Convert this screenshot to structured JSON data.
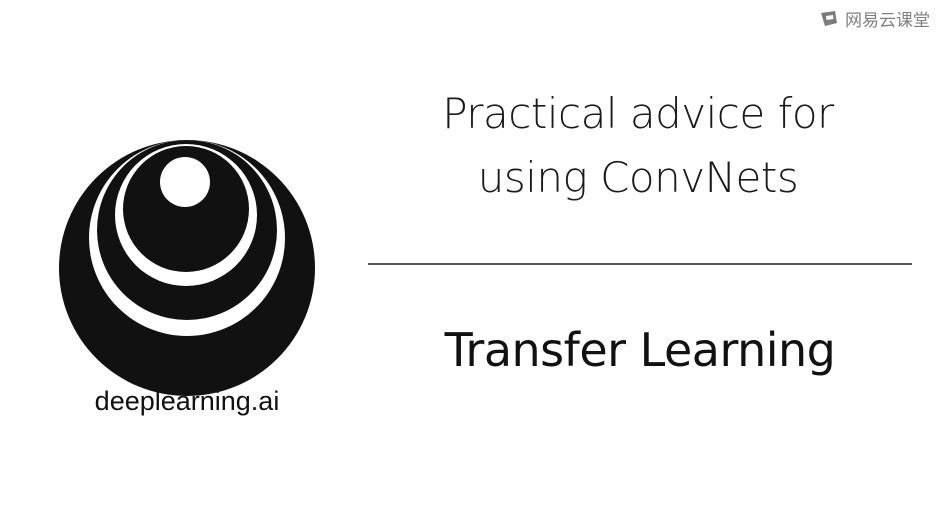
{
  "watermark": {
    "text": "网易云课堂",
    "icon": "netease-classroom-icon"
  },
  "logo": {
    "icon": "deeplearning-logo-icon",
    "text": "deeplearning.ai"
  },
  "title": {
    "line1": "Practical advice for",
    "line2": "using ConvNets"
  },
  "subtitle": "Transfer Learning"
}
